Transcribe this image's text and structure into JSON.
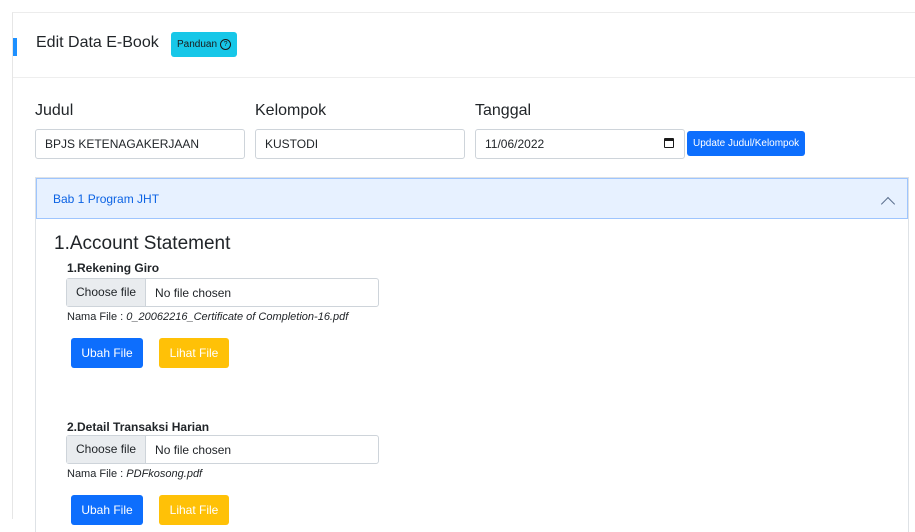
{
  "header": {
    "title": "Edit Data E-Book",
    "guide_label": "Panduan",
    "guide_icon": "question-circle-icon"
  },
  "form": {
    "judul_label": "Judul",
    "judul_value": "BPJS KETENAGAKERJAAN",
    "kelompok_label": "Kelompok",
    "kelompok_value": "KUSTODI",
    "tanggal_label": "Tanggal",
    "tanggal_value": "11/06/2022",
    "update_button": "Update Judul/Kelompok"
  },
  "accordion": {
    "title": "Bab 1 Program JHT",
    "section_title": "1.Account Statement",
    "items": [
      {
        "title": "1.Rekening Giro",
        "choose_label": "Choose file",
        "no_file_label": "No file chosen",
        "filename_prefix": "Nama File : ",
        "filename": "0_20062216_Certificate of Completion-16.pdf",
        "ubah_label": "Ubah File",
        "lihat_label": "Lihat File"
      },
      {
        "title": "2.Detail Transaksi Harian",
        "choose_label": "Choose file",
        "no_file_label": "No file chosen",
        "filename_prefix": "Nama File : ",
        "filename": "PDFkosong.pdf",
        "ubah_label": "Ubah File",
        "lihat_label": "Lihat File"
      }
    ]
  },
  "colors": {
    "primary": "#0d6efd",
    "warning": "#ffc107",
    "info": "#17c7e8",
    "accordion_bg": "#e7f1ff"
  }
}
